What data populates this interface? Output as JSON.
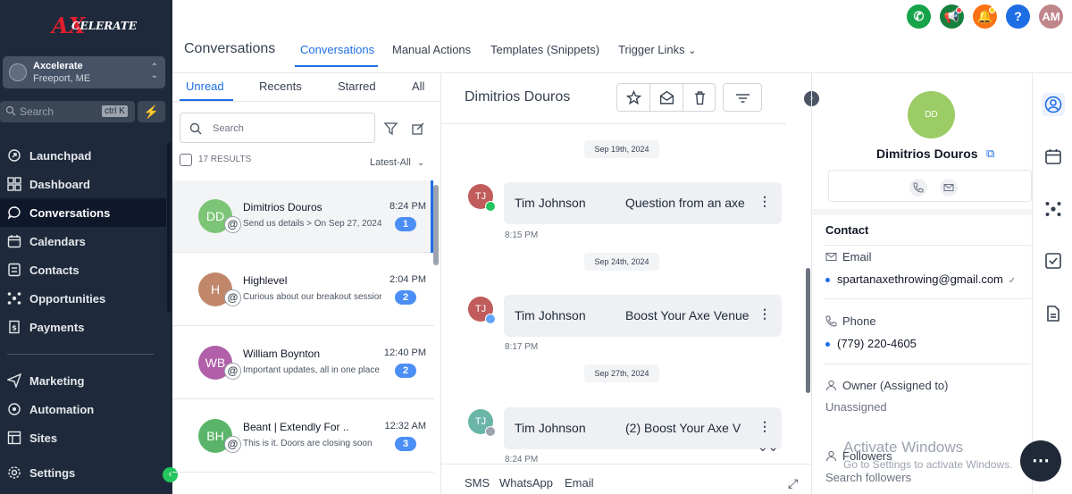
{
  "brand": {
    "logo_text": "AXCELERATE"
  },
  "location": {
    "name": "Axcelerate",
    "city": "Freeport, ME"
  },
  "search": {
    "label": "Search",
    "shortcut": "ctrl K"
  },
  "sidebar": {
    "items": [
      {
        "label": "Launchpad",
        "icon": "launchpad-icon"
      },
      {
        "label": "Dashboard",
        "icon": "dashboard-icon"
      },
      {
        "label": "Conversations",
        "icon": "chat-icon"
      },
      {
        "label": "Calendars",
        "icon": "calendar-icon"
      },
      {
        "label": "Contacts",
        "icon": "contacts-icon"
      },
      {
        "label": "Opportunities",
        "icon": "opportunities-icon"
      },
      {
        "label": "Payments",
        "icon": "payments-icon"
      },
      {
        "label": "Marketing",
        "icon": "send-icon"
      },
      {
        "label": "Automation",
        "icon": "automation-icon"
      },
      {
        "label": "Sites",
        "icon": "sites-icon"
      },
      {
        "label": "Settings",
        "icon": "gear-icon"
      }
    ]
  },
  "header": {
    "title": "Conversations",
    "tabs": [
      {
        "label": "Conversations"
      },
      {
        "label": "Manual Actions"
      },
      {
        "label": "Templates (Snippets)"
      },
      {
        "label": "Trigger Links"
      }
    ],
    "avatar": "AM",
    "help": "?"
  },
  "list": {
    "filter_tabs": [
      "Unread",
      "Recents",
      "Starred",
      "All"
    ],
    "search_placeholder": "Search",
    "results": "17 RESULTS",
    "sort": "Latest-All",
    "conversations": [
      {
        "initials": "DD",
        "name": "Dimitrios Douros",
        "preview": "Send us details  > On Sep 27, 2024",
        "time": "8:24 PM",
        "count": "1",
        "color": "#7cc576"
      },
      {
        "initials": "H",
        "name": "Highlevel",
        "preview": "Curious about our breakout sessions",
        "time": "2:04 PM",
        "count": "2",
        "color": "#c1876b"
      },
      {
        "initials": "WB",
        "name": "William Boynton",
        "preview": "Important updates, all in one place",
        "time": "12:40 PM",
        "count": "2",
        "color": "#b05fa8"
      },
      {
        "initials": "BH",
        "name": "Beant | Extendly For ..",
        "preview": "This is it. Doors are closing soon",
        "time": "12:32 AM",
        "count": "3",
        "color": "#5ab56a"
      }
    ]
  },
  "chat": {
    "contact_name": "Dimitrios Douros",
    "messages": [
      {
        "date": "Sep 19th, 2024",
        "avatar": "TJ",
        "from": "Tim Johnson",
        "subject": "Question from an axe",
        "time": "8:15 PM",
        "color": "#c05c5c"
      },
      {
        "date": "Sep 24th, 2024",
        "avatar": "TJ",
        "from": "Tim Johnson",
        "subject": "Boost Your Axe Venue",
        "time": "8:17 PM",
        "color": "#c05c5c"
      },
      {
        "date": "Sep 27th, 2024",
        "avatar": "TJ",
        "from": "Tim Johnson",
        "subject": "(2)  Boost Your Axe V",
        "time": "8:24 PM",
        "color": "#6bb5a8"
      }
    ],
    "channels": [
      "SMS",
      "WhatsApp",
      "Email"
    ]
  },
  "contact": {
    "initials": "DD",
    "name": "Dimitrios Douros",
    "section": "Contact",
    "email_label": "Email",
    "email": "spartanaxethrowing@gmail.com",
    "phone_label": "Phone",
    "phone": "(779) 220-4605",
    "owner_label": "Owner (Assigned to)",
    "owner": "Unassigned",
    "followers_label": "Followers",
    "followers_search": "Search followers"
  },
  "watermark": {
    "title": "Activate Windows",
    "sub": "Go to Settings to activate Windows."
  },
  "colors": {
    "sidebar": "#1e2a3b",
    "accent": "#1d6ee5",
    "badge": "#4b8ef6"
  }
}
